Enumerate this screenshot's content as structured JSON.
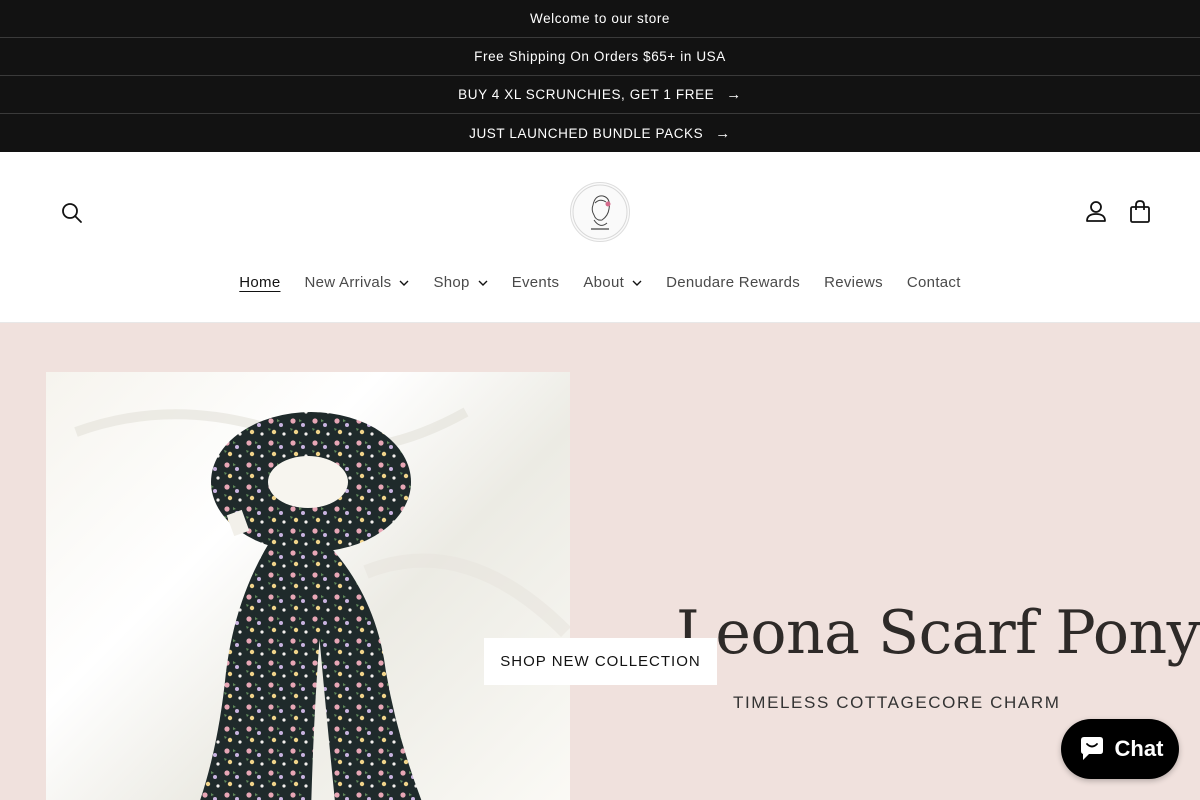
{
  "announcements": [
    {
      "text": "Welcome to our store",
      "has_arrow": false
    },
    {
      "text": "Free Shipping On Orders $65+ in USA",
      "has_arrow": false
    },
    {
      "text": "BUY 4 XL SCRUNCHIES, GET 1 FREE",
      "has_arrow": true
    },
    {
      "text": "JUST LAUNCHED BUNDLE PACKS",
      "has_arrow": true
    }
  ],
  "header": {
    "search_icon": "search-icon",
    "logo_icon": "brand-logo",
    "account_icon": "account-icon",
    "cart_icon": "cart-icon"
  },
  "nav": {
    "items": [
      {
        "label": "Home",
        "active": true,
        "dropdown": false
      },
      {
        "label": "New Arrivals",
        "active": false,
        "dropdown": true
      },
      {
        "label": "Shop",
        "active": false,
        "dropdown": true
      },
      {
        "label": "Events",
        "active": false,
        "dropdown": false
      },
      {
        "label": "About",
        "active": false,
        "dropdown": true
      },
      {
        "label": "Denudare Rewards",
        "active": false,
        "dropdown": false
      },
      {
        "label": "Reviews",
        "active": false,
        "dropdown": false
      },
      {
        "label": "Contact",
        "active": false,
        "dropdown": false
      }
    ]
  },
  "hero": {
    "title": "Leona Scarf Pony",
    "subtitle": "TIMELESS COTTAGECORE CHARM",
    "cta_label": "SHOP NEW COLLECTION",
    "background": "#f0e1dd"
  },
  "chat": {
    "label": "Chat"
  }
}
